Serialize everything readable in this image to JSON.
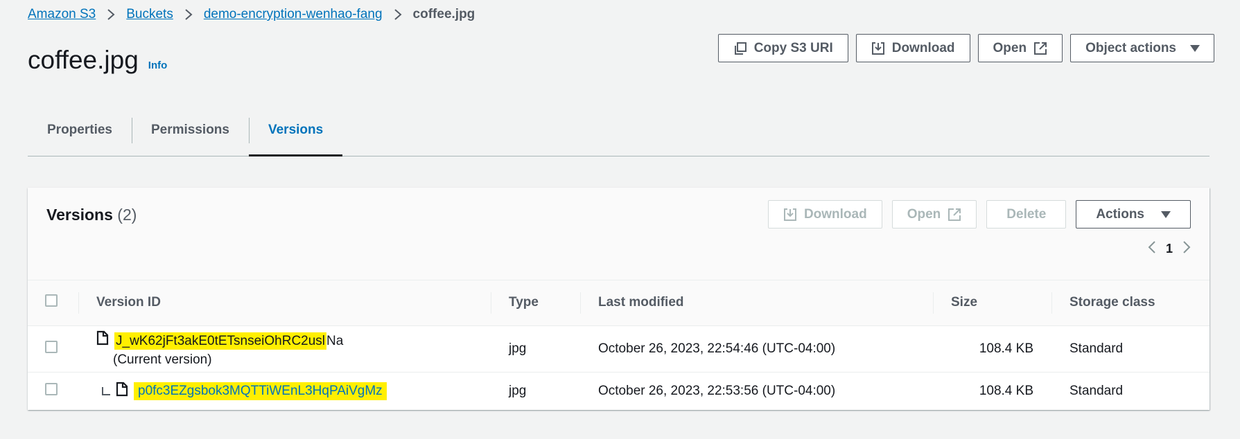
{
  "breadcrumb": {
    "items": [
      "Amazon S3",
      "Buckets",
      "demo-encryption-wenhao-fang"
    ],
    "current": "coffee.jpg"
  },
  "page": {
    "title": "coffee.jpg",
    "info_label": "Info"
  },
  "top_actions": {
    "copy_uri": "Copy S3 URI",
    "download": "Download",
    "open": "Open",
    "object_actions": "Object actions"
  },
  "tabs": [
    {
      "label": "Properties",
      "active": false
    },
    {
      "label": "Permissions",
      "active": false
    },
    {
      "label": "Versions",
      "active": true
    }
  ],
  "versions": {
    "title": "Versions",
    "count": "(2)",
    "actions": {
      "download": "Download",
      "open": "Open",
      "delete": "Delete",
      "actions": "Actions"
    },
    "pagination": {
      "page": "1"
    },
    "columns": [
      "Version ID",
      "Type",
      "Last modified",
      "Size",
      "Storage class"
    ],
    "rows": [
      {
        "version_id_highlighted": "J_wK62jFt3akE0tETsnseiOhRC2usl",
        "version_id_rest": "Na",
        "current_label": "(Current version)",
        "type": "jpg",
        "last_modified": "October 26, 2023, 22:54:46 (UTC-04:00)",
        "size": "108.4 KB",
        "storage_class": "Standard"
      },
      {
        "version_id": "p0fc3EZgsbok3MQTTiWEnL3HqPAiVgMz",
        "type": "jpg",
        "last_modified": "October 26, 2023, 22:53:56 (UTC-04:00)",
        "size": "108.4 KB",
        "storage_class": "Standard"
      }
    ]
  },
  "colors": {
    "link": "#0073bb",
    "highlight": "#ffef00",
    "background": "#f2f3f3"
  }
}
